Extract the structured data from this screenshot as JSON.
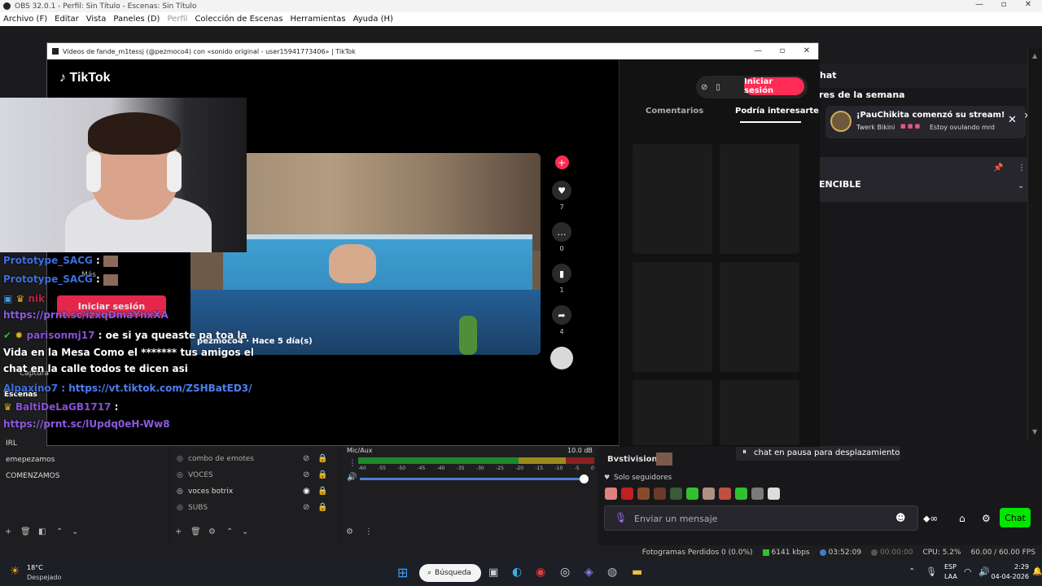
{
  "obs": {
    "title": "OBS 32.0.1 - Perfil: Sin Título - Escenas: Sin Título",
    "menu": [
      "Archivo (F)",
      "Editar",
      "Vista",
      "Paneles (D)",
      "Perfil",
      "Colección de Escenas",
      "Herramientas",
      "Ayuda (H)"
    ],
    "scenes_label": "Escenas",
    "scenes": [
      "IRL",
      "emepezamos",
      "COMENZAMOS"
    ],
    "sources": [
      {
        "name": "combo de emotes"
      },
      {
        "name": "VOCES"
      },
      {
        "name": "voces botrix"
      },
      {
        "name": "SUBS"
      }
    ],
    "mixer": {
      "track": "Mic/Aux",
      "db": "10.0 dB",
      "ticks": [
        "-60",
        "-55",
        "-50",
        "-45",
        "-40",
        "-35",
        "-30",
        "-25",
        "-20",
        "-15",
        "-10",
        "-5",
        "0"
      ]
    },
    "status": {
      "dropped": "Fotogramas Perdidos 0 (0.0%)",
      "bitrate": "6141 kbps",
      "stream_time": "03:52:09",
      "rec_time": "00:00:00",
      "cpu": "CPU: 5.2%",
      "fps": "60.00 / 60.00 FPS"
    }
  },
  "tiktok": {
    "window_title": "Videos de fande_m1tessj (@pezmoco4) con «sonido original - user15941773406» | TikTok",
    "logo": "TikTok",
    "login": "Iniciar sesión",
    "tabs": [
      "Comentarios",
      "Podría interesarte"
    ],
    "author": "pezmoco4 · Hace 5 día(s)",
    "counts": [
      "7",
      "0",
      "1",
      "4"
    ]
  },
  "chat_dock": {
    "header": "Chat",
    "week": "res de la semana",
    "notif_title": "¡PauChikita comenzó su stream!",
    "notif_sub1": "Twerk Bikini",
    "notif_sub2": "Estoy ovulando mrd",
    "pinned": "ENCIBLE",
    "user_bottom": "Bvstivision:",
    "paused": "chat en pausa para desplazamiento",
    "followers_only": "Solo seguidores",
    "input_placeholder": "Enviar un mensaje",
    "chat_button": "Chat"
  },
  "overlay": {
    "lines": [
      {
        "user": "Prototype_SACG",
        "sep": " :"
      },
      {
        "user": "Prototype_SACG",
        "sep": " :"
      },
      {
        "user": "nik",
        "link": "https://prnt.sc/izxqDmaYnxXA"
      },
      {
        "user": "parisonmj17",
        "msg": " : oe si ya queaste pa toa la"
      },
      {
        "msg": "Vida en la Mesa Como el ******* tus amigos el"
      },
      {
        "msg": "chat en la calle todos te dicen asi"
      },
      {
        "user": "Alpaxino7",
        "link": " : https://vt.tiktok.com/ZSHBatED3/"
      },
      {
        "user": "BaltiDeLaGB1717",
        "sep": " :"
      },
      {
        "link": "https://prnt.sc/lUpdq0eH-Ww8"
      }
    ],
    "captura": "Captura",
    "mas": "Más"
  },
  "taskbar": {
    "weather_temp": "18°C",
    "weather_desc": "Despejado",
    "search": "Búsqueda",
    "lang1": "ESP",
    "lang2": "LAA",
    "time": "2:29",
    "date": "04-04-2026"
  },
  "colors": {
    "tiktok_red": "#fe2c55",
    "twitch_green": "#00e600",
    "overlay_blue": "#3c6fe0",
    "overlay_purple": "#8a4fd8"
  }
}
